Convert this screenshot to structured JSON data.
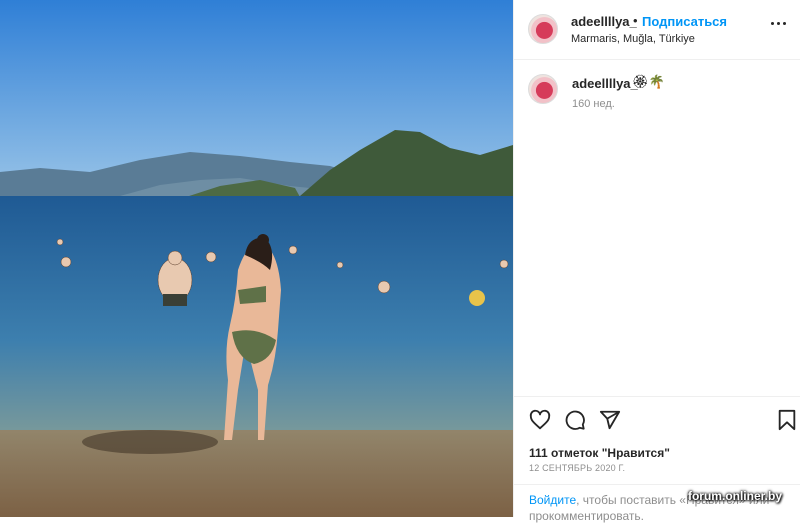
{
  "post": {
    "username": "adeellllya_",
    "separator": "•",
    "follow_label": "Подписаться",
    "location": "Marmaris, Muğla, Türkiye"
  },
  "caption": {
    "username": "adeellllya_",
    "emoji": "🏵🌴",
    "age": "160 нед."
  },
  "actions": {
    "like_icon": "heart-icon",
    "comment_icon": "comment-icon",
    "share_icon": "share-icon",
    "save_icon": "bookmark-icon",
    "likes_text": "111 отметок \"Нравится\"",
    "date": "12 СЕНТЯБРЬ 2020 Г."
  },
  "login": {
    "link": "Войдите",
    "text": ", чтобы поставить «Нравится» или прокомментировать."
  },
  "watermark": "forum.onliner.by",
  "colors": {
    "accent": "#0095f6",
    "text": "#262626",
    "muted": "#8e8e8e",
    "border": "#efefef"
  }
}
